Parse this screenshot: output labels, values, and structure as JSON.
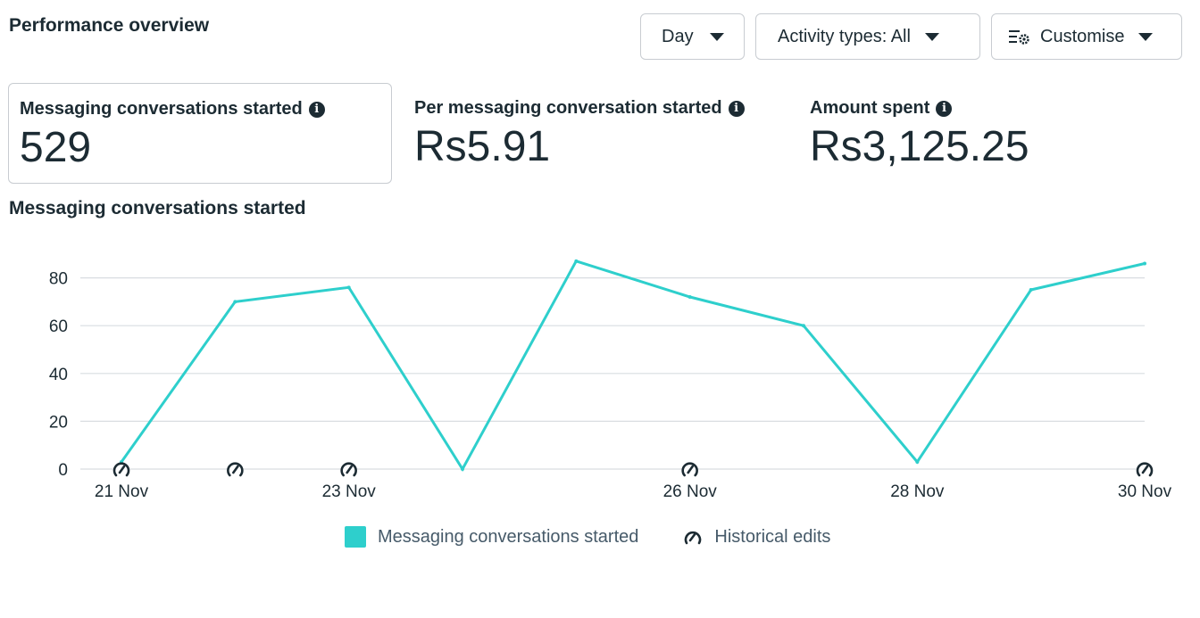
{
  "header": {
    "title": "Performance overview",
    "day_label": "Day",
    "activity_label": "Activity types: All",
    "customise_label": "Customise"
  },
  "metrics": [
    {
      "label": "Messaging conversations started",
      "value": "529"
    },
    {
      "label": "Per messaging conversation started",
      "value": "Rs5.91"
    },
    {
      "label": "Amount spent",
      "value": "Rs3,125.25"
    }
  ],
  "chart_title": "Messaging conversations started",
  "colors": {
    "line": "#2ecfcc",
    "grid": "#d9dde1",
    "text": "#1c2b33"
  },
  "legend": {
    "series_label": "Messaging conversations started",
    "edits_label": "Historical edits"
  },
  "chart_data": {
    "type": "line",
    "x": [
      "21 Nov",
      "22 Nov",
      "23 Nov",
      "24 Nov",
      "25 Nov",
      "26 Nov",
      "27 Nov",
      "28 Nov",
      "29 Nov",
      "30 Nov"
    ],
    "x_tick_labels": [
      "21 Nov",
      "23 Nov",
      "26 Nov",
      "28 Nov",
      "30 Nov"
    ],
    "series": [
      {
        "name": "Messaging conversations started",
        "values": [
          3,
          70,
          76,
          0,
          87,
          72,
          60,
          3,
          75,
          86
        ]
      }
    ],
    "yticks": [
      0,
      20,
      40,
      60,
      80
    ],
    "ylim": [
      0,
      90
    ],
    "grid": true,
    "legend_position": "bottom",
    "historical_edits": [
      "21 Nov",
      "22 Nov",
      "23 Nov",
      "26 Nov",
      "30 Nov"
    ]
  }
}
